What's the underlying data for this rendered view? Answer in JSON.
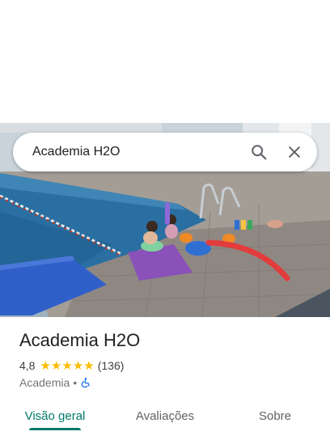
{
  "search": {
    "value": "Academia H2O"
  },
  "place": {
    "name": "Academia H2O",
    "rating": "4,8",
    "stars": 5,
    "review_count": "(136)",
    "category": "Academia",
    "separator": "•"
  },
  "icons": [
    "search-icon",
    "close-icon",
    "wheelchair-accessible-icon",
    "star-icon"
  ],
  "tabs": [
    {
      "label": "Visão geral",
      "active": true
    },
    {
      "label": "Avaliações",
      "active": false
    },
    {
      "label": "Sobre",
      "active": false
    }
  ],
  "colors": {
    "star": "#fbbc04",
    "accent": "#00796b",
    "accessibility": "#1a73e8"
  }
}
